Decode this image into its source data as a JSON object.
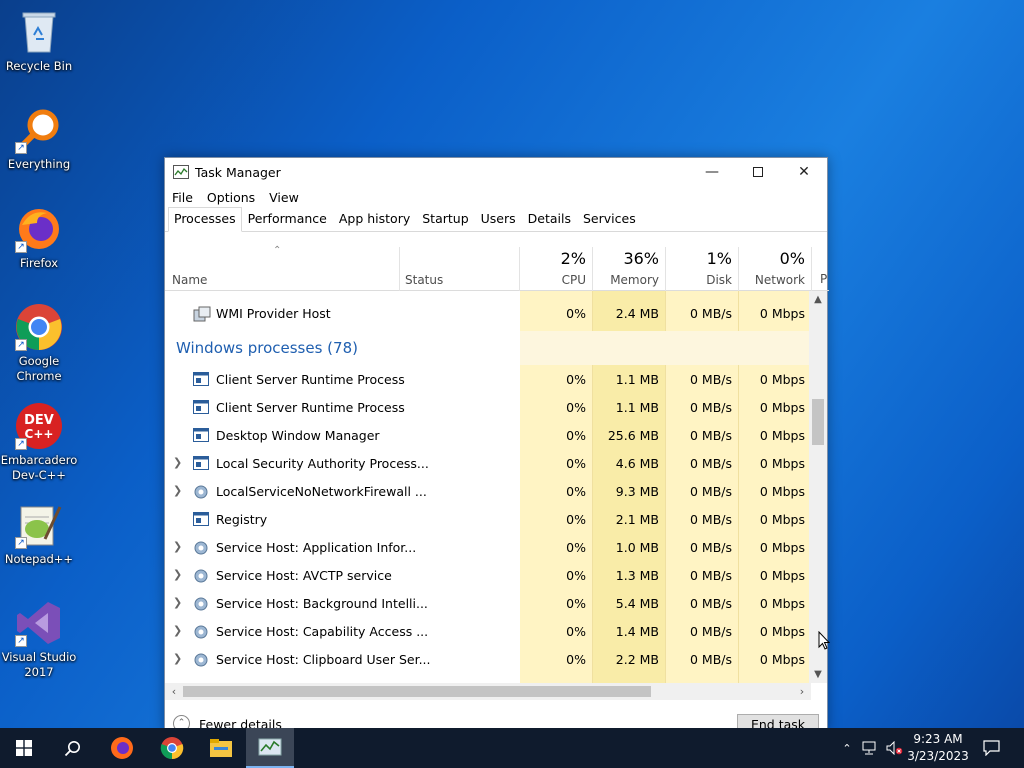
{
  "desktop": {
    "icons": [
      {
        "label": "Recycle Bin",
        "icon": "recycle-bin-icon"
      },
      {
        "label": "Everything",
        "icon": "everything-search-icon"
      },
      {
        "label": "Firefox",
        "icon": "firefox-icon"
      },
      {
        "label": "Google\nChrome",
        "icon": "chrome-icon"
      },
      {
        "label": "Embarcadero\nDev-C++",
        "icon": "devcpp-icon"
      },
      {
        "label": "Notepad++",
        "icon": "notepadpp-icon"
      },
      {
        "label": "Visual Studio\n2017",
        "icon": "visual-studio-icon"
      }
    ]
  },
  "window": {
    "title": "Task Manager",
    "menu": [
      "File",
      "Options",
      "View"
    ],
    "tabs": [
      "Processes",
      "Performance",
      "App history",
      "Startup",
      "Users",
      "Details",
      "Services"
    ],
    "active_tab": "Processes",
    "columns": {
      "name": "Name",
      "status": "Status",
      "cpu": {
        "pct": "2%",
        "label": "CPU"
      },
      "memory": {
        "pct": "36%",
        "label": "Memory"
      },
      "disk": {
        "pct": "1%",
        "label": "Disk"
      },
      "network": {
        "pct": "0%",
        "label": "Network"
      },
      "power_partial": "P"
    },
    "group_header": "Windows processes (78)",
    "top_row": {
      "name": "WMI Provider Host",
      "cpu": "0%",
      "memory": "2.4 MB",
      "disk": "0 MB/s",
      "network": "0 Mbps"
    },
    "rows": [
      {
        "name": "Client Server Runtime Process",
        "expand": false,
        "icon": "window-icon",
        "cpu": "0%",
        "memory": "1.1 MB",
        "disk": "0 MB/s",
        "network": "0 Mbps"
      },
      {
        "name": "Client Server Runtime Process",
        "expand": false,
        "icon": "window-icon",
        "cpu": "0%",
        "memory": "1.1 MB",
        "disk": "0 MB/s",
        "network": "0 Mbps"
      },
      {
        "name": "Desktop Window Manager",
        "expand": false,
        "icon": "window-icon",
        "cpu": "0%",
        "memory": "25.6 MB",
        "disk": "0 MB/s",
        "network": "0 Mbps"
      },
      {
        "name": "Local Security Authority Process...",
        "expand": true,
        "icon": "window-icon",
        "cpu": "0%",
        "memory": "4.6 MB",
        "disk": "0 MB/s",
        "network": "0 Mbps"
      },
      {
        "name": "LocalServiceNoNetworkFirewall ...",
        "expand": true,
        "icon": "gear-icon",
        "cpu": "0%",
        "memory": "9.3 MB",
        "disk": "0 MB/s",
        "network": "0 Mbps"
      },
      {
        "name": "Registry",
        "expand": false,
        "icon": "window-icon",
        "cpu": "0%",
        "memory": "2.1 MB",
        "disk": "0 MB/s",
        "network": "0 Mbps"
      },
      {
        "name": "Service Host: Application Infor...",
        "expand": true,
        "icon": "gear-icon",
        "cpu": "0%",
        "memory": "1.0 MB",
        "disk": "0 MB/s",
        "network": "0 Mbps"
      },
      {
        "name": "Service Host: AVCTP service",
        "expand": true,
        "icon": "gear-icon",
        "cpu": "0%",
        "memory": "1.3 MB",
        "disk": "0 MB/s",
        "network": "0 Mbps"
      },
      {
        "name": "Service Host: Background Intelli...",
        "expand": true,
        "icon": "gear-icon",
        "cpu": "0%",
        "memory": "5.4 MB",
        "disk": "0 MB/s",
        "network": "0 Mbps"
      },
      {
        "name": "Service Host: Capability Access ...",
        "expand": true,
        "icon": "gear-icon",
        "cpu": "0%",
        "memory": "1.4 MB",
        "disk": "0 MB/s",
        "network": "0 Mbps"
      },
      {
        "name": "Service Host: Clipboard User Ser...",
        "expand": true,
        "icon": "gear-icon",
        "cpu": "0%",
        "memory": "2.2 MB",
        "disk": "0 MB/s",
        "network": "0 Mbps"
      }
    ],
    "fewer_details": "Fewer details",
    "end_task": "End task"
  },
  "taskbar": {
    "apps": [
      "firefox-icon",
      "chrome-icon",
      "file-explorer-icon",
      "task-manager-icon"
    ],
    "time": "9:23 AM",
    "date": "3/23/2023"
  },
  "colors": {
    "accent": "#0078d7",
    "cpu_highlight": "#fff4c4",
    "group": "#1f5fb0"
  }
}
